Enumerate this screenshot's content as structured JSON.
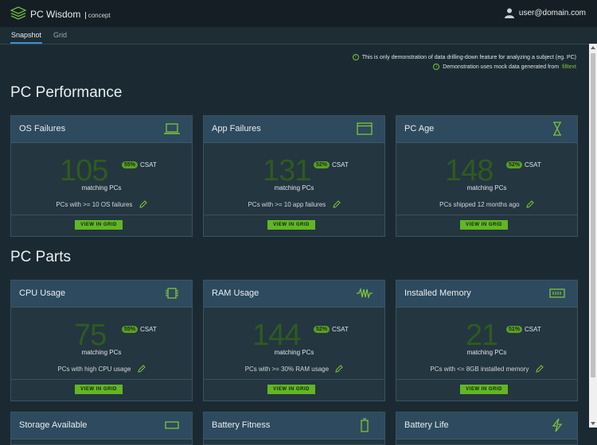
{
  "header": {
    "title": "PC Wisdom",
    "subtitle": "concept",
    "user": "user@domain.com"
  },
  "tabs": [
    {
      "label": "Snapshot",
      "active": true
    },
    {
      "label": "Grid",
      "active": false
    }
  ],
  "notes": {
    "line1": "This is only demonstration of data drilling-down feature for analyzing a subject (eg. PC)",
    "line2_text": "Demonstration uses mock data generated from",
    "line2_link": "filltext"
  },
  "sections": [
    {
      "title": "PC Performance"
    },
    {
      "title": "PC Parts"
    }
  ],
  "cards": [
    {
      "title": "OS Failures",
      "icon": "laptop-icon",
      "count": "105",
      "csat": "55%",
      "csat_label": "CSAT",
      "matching": "matching PCs",
      "desc": "PCs with >= 10 OS failures",
      "button": "VIEW IN GRID"
    },
    {
      "title": "App Failures",
      "icon": "window-icon",
      "count": "131",
      "csat": "52%",
      "csat_label": "CSAT",
      "matching": "matching PCs",
      "desc": "PCs with >= 10 app failures",
      "button": "VIEW IN GRID"
    },
    {
      "title": "PC Age",
      "icon": "hourglass-icon",
      "count": "148",
      "csat": "52%",
      "csat_label": "CSAT",
      "matching": "matching PCs",
      "desc": "PCs shipped 12 months ago",
      "button": "VIEW IN GRID"
    },
    {
      "title": "CPU Usage",
      "icon": "cpu-icon",
      "count": "75",
      "csat": "55%",
      "csat_label": "CSAT",
      "matching": "matching PCs",
      "desc": "PCs with high CPU usage",
      "button": "VIEW IN GRID"
    },
    {
      "title": "RAM Usage",
      "icon": "waveform-icon",
      "count": "144",
      "csat": "52%",
      "csat_label": "CSAT",
      "matching": "matching PCs",
      "desc": "PCs with >= 30% RAM usage",
      "button": "VIEW IN GRID"
    },
    {
      "title": "Installed Memory",
      "icon": "memory-icon",
      "count": "21",
      "csat": "51%",
      "csat_label": "CSAT",
      "matching": "matching PCs",
      "desc": "PCs with <= 8GB installed memory",
      "button": "VIEW IN GRID"
    },
    {
      "title": "Storage Available",
      "icon": "storage-icon"
    },
    {
      "title": "Battery Fitness",
      "icon": "battery-icon"
    },
    {
      "title": "Battery Life",
      "icon": "bolt-icon"
    }
  ],
  "colors": {
    "accent": "#62b624",
    "header_bg": "#141e24",
    "card_head": "#2e4a5e"
  }
}
